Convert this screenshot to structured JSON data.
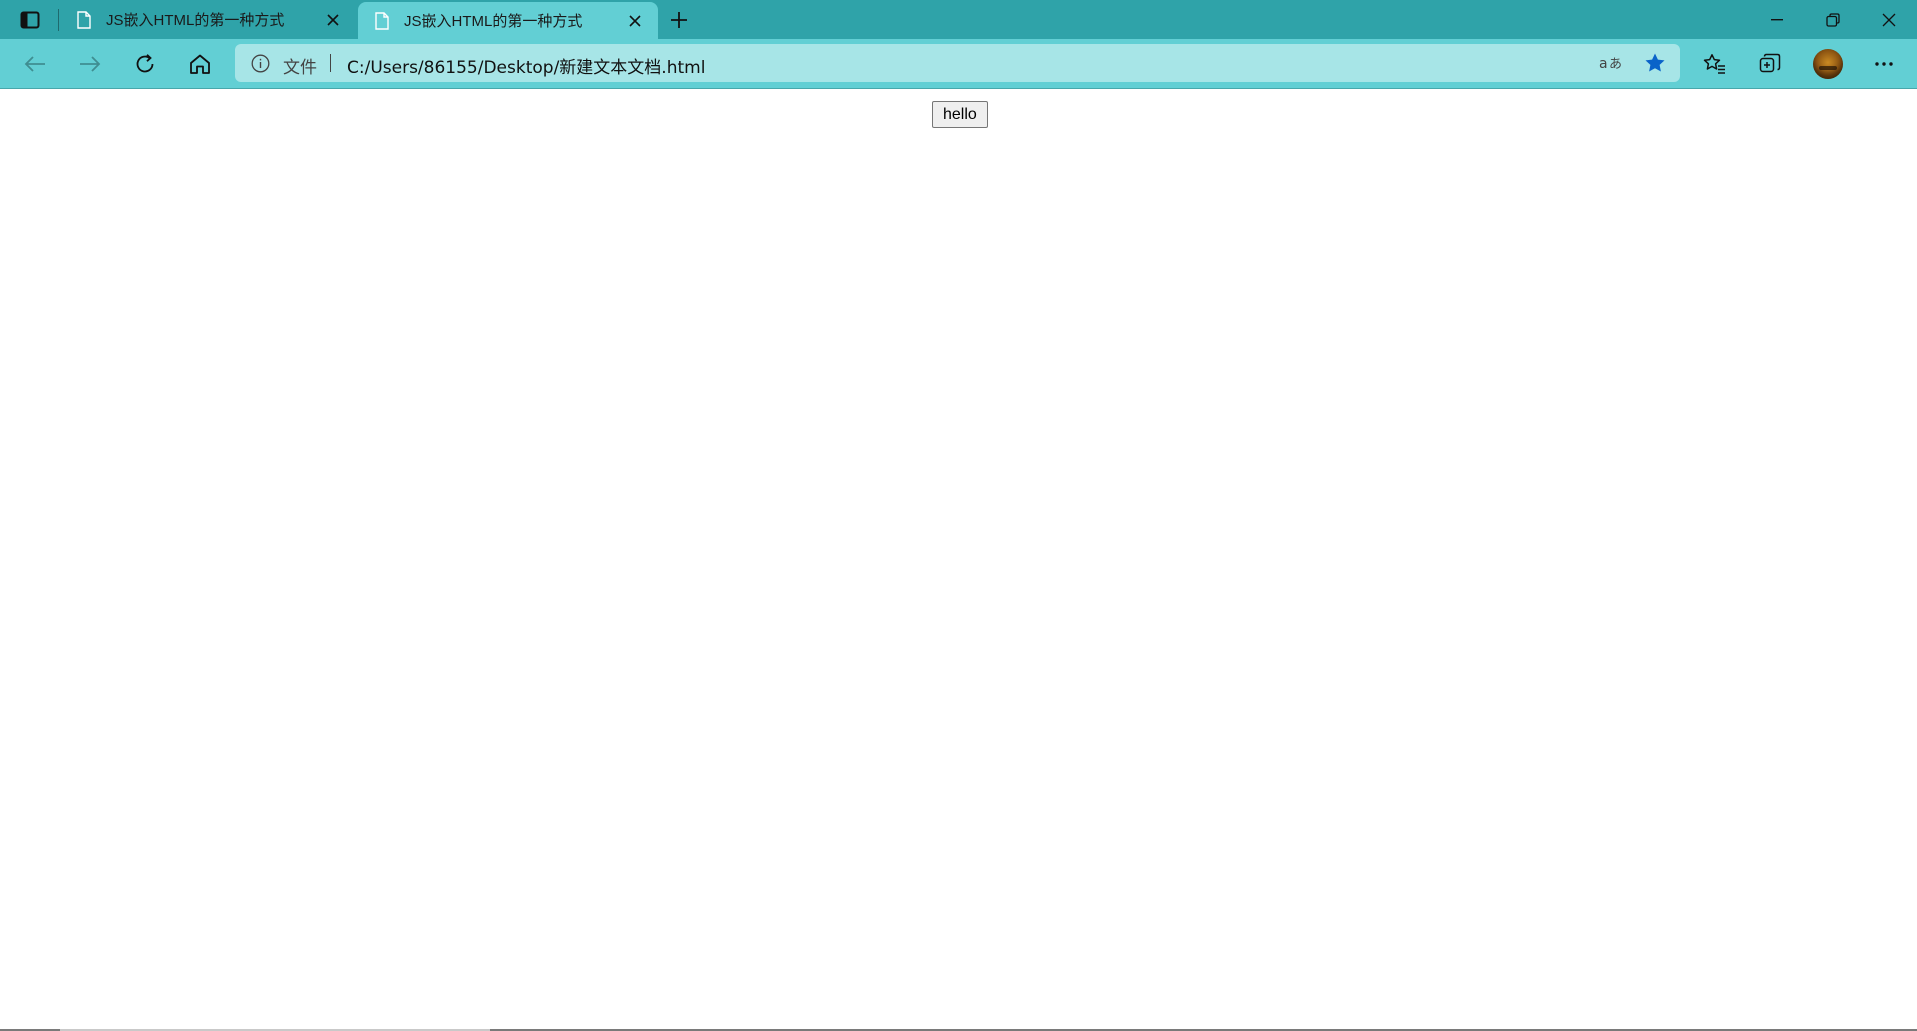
{
  "browser": {
    "tabs": [
      {
        "title": "JS嵌入HTML的第一种方式",
        "active": false
      },
      {
        "title": "JS嵌入HTML的第一种方式",
        "active": true
      }
    ],
    "address_bar": {
      "label": "文件",
      "url": "C:/Users/86155/Desktop/新建文本文档.html"
    },
    "icons": {
      "tab_actions": "tab-actions-icon",
      "page": "page-icon",
      "close": "close-icon",
      "new_tab": "plus-icon",
      "minimize": "minimize-icon",
      "restore": "restore-icon",
      "window_close": "close-icon",
      "back": "back-arrow-icon",
      "forward": "forward-arrow-icon",
      "refresh": "refresh-icon",
      "home": "home-icon",
      "info": "info-icon",
      "read_aloud": "read-aloud-icon",
      "favorite": "star-icon",
      "favorites": "favorites-icon",
      "collections": "collections-icon",
      "profile": "avatar",
      "more": "more-icon"
    },
    "colors": {
      "tabstrip": "#2fa3a9",
      "toolbar": "#62cfd4",
      "address_bar": "#a7e5e7",
      "favorite_star": "#0a63c9"
    }
  },
  "page": {
    "button_label": "hello"
  }
}
